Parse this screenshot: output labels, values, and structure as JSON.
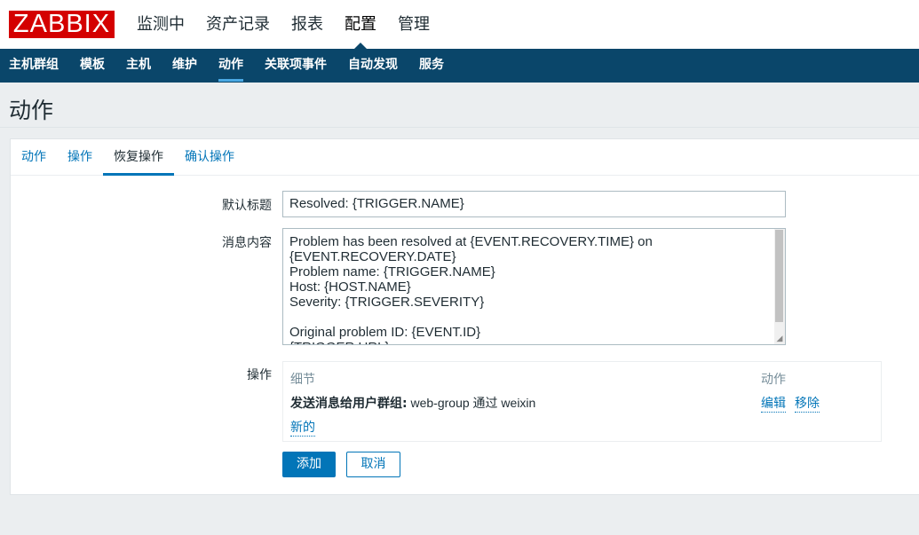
{
  "logo": "ZABBIX",
  "top_menu": [
    "监测中",
    "资产记录",
    "报表",
    "配置",
    "管理"
  ],
  "top_menu_active": "配置",
  "sub_nav": [
    "主机群组",
    "模板",
    "主机",
    "维护",
    "动作",
    "关联项事件",
    "自动发现",
    "服务"
  ],
  "sub_nav_active": "动作",
  "page_title": "动作",
  "tabs": [
    "动作",
    "操作",
    "恢复操作",
    "确认操作"
  ],
  "tabs_active": "恢复操作",
  "form": {
    "subject_label": "默认标题",
    "subject_value": "Resolved: {TRIGGER.NAME}",
    "message_label": "消息内容",
    "message_value": "Problem has been resolved at {EVENT.RECOVERY.TIME} on\n{EVENT.RECOVERY.DATE}\nProblem name: {TRIGGER.NAME}\nHost: {HOST.NAME}\nSeverity: {TRIGGER.SEVERITY}\n\nOriginal problem ID: {EVENT.ID}\n{TRIGGER.URL}",
    "operations_label": "操作"
  },
  "operations": {
    "col_details": "细节",
    "col_action": "动作",
    "row_bold": "发送消息给用户群组:",
    "row_rest": " web-group 通过 weixin",
    "edit_link": "编辑",
    "remove_link": "移除",
    "new_link": "新的"
  },
  "buttons": {
    "add": "添加",
    "cancel": "取消"
  },
  "colors": {
    "logo_bg": "#d40000",
    "nav_bg": "#0a466a",
    "accent": "#0275b8"
  }
}
